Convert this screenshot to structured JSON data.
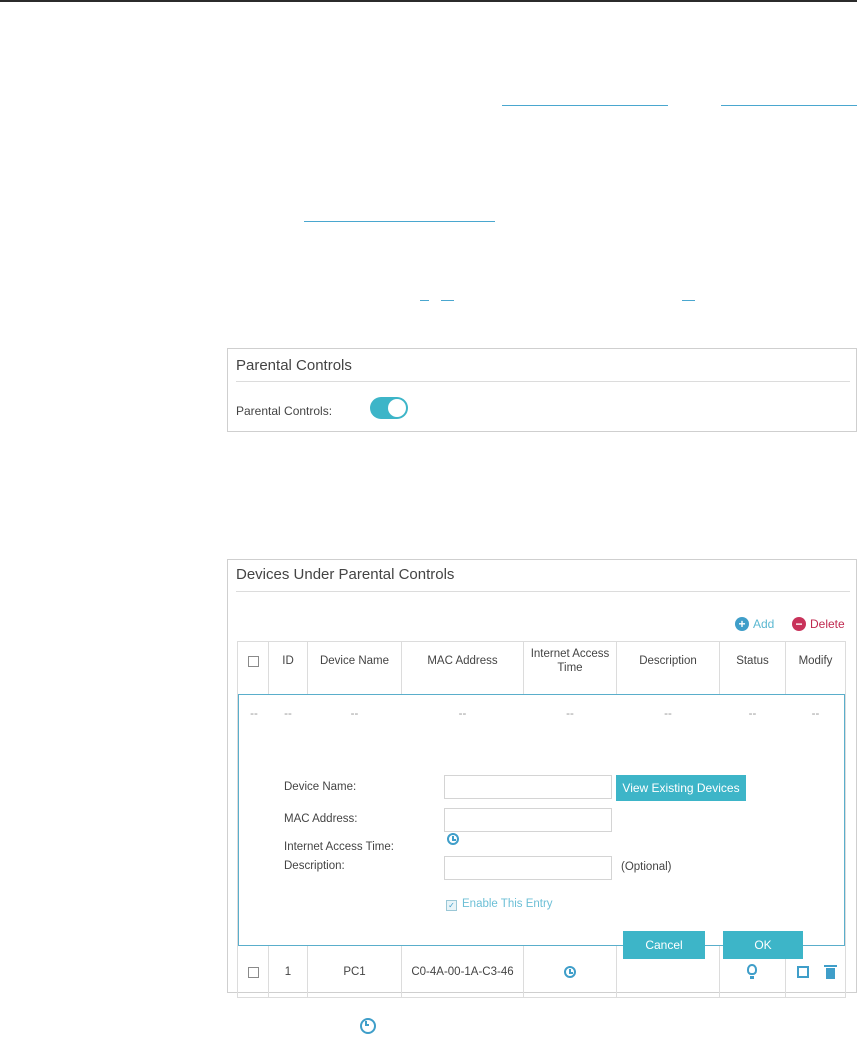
{
  "parental_panel": {
    "title": "Parental Controls",
    "toggle_label": "Parental Controls:",
    "toggle_state": "on"
  },
  "devices_panel": {
    "title": "Devices Under Parental Controls",
    "add_label": "Add",
    "delete_label": "Delete",
    "columns": [
      "ID",
      "Device Name",
      "MAC Address",
      "Internet Access Time",
      "Description",
      "Status",
      "Modify"
    ],
    "placeholder_mark": "--",
    "form": {
      "device_name_label": "Device Name:",
      "mac_label": "MAC Address:",
      "access_time_label": "Internet Access Time:",
      "description_label": "Description:",
      "optional_note": "(Optional)",
      "view_devices_label": "View Existing Devices",
      "enable_entry_label": "Enable This Entry",
      "enable_entry_checked": true,
      "cancel_label": "Cancel",
      "ok_label": "OK"
    },
    "rows": [
      {
        "id": "1",
        "device_name": "PC1",
        "mac": "C0-4A-00-1A-C3-46",
        "description": ""
      }
    ]
  },
  "colors": {
    "accent": "#3db5c8",
    "link": "#4aa7cf",
    "delete": "#c8325a"
  }
}
